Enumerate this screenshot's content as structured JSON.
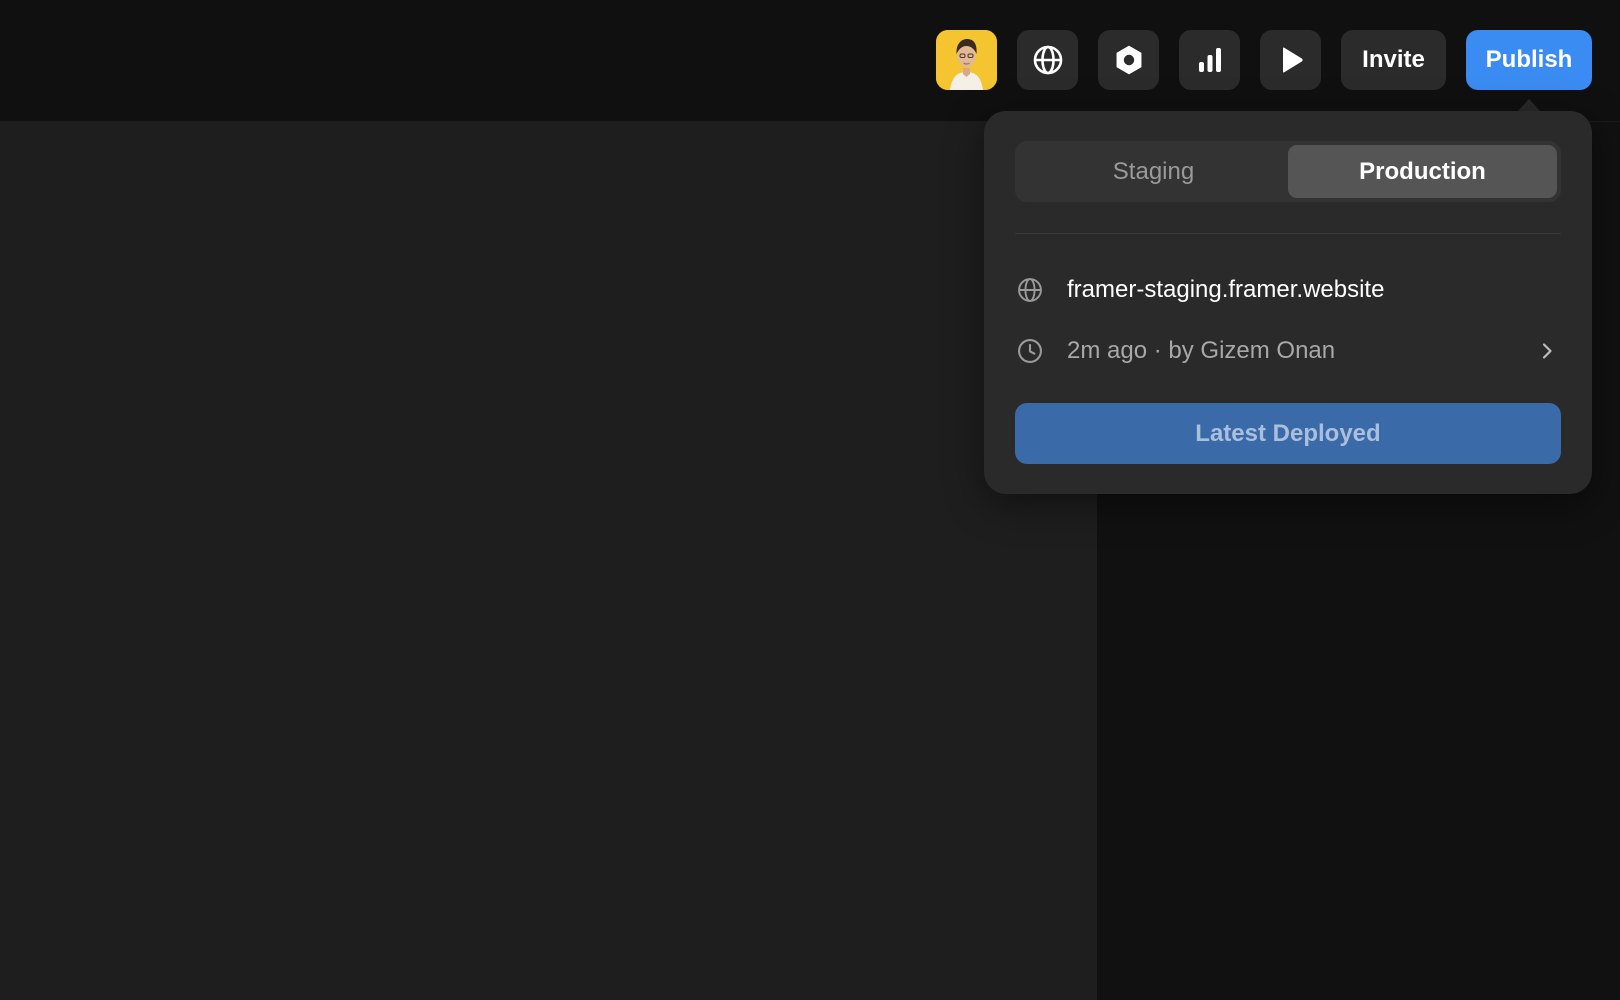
{
  "toolbar": {
    "avatar_icon": "user-avatar",
    "buttons": [
      {
        "icon": "globe-icon"
      },
      {
        "icon": "settings-hexagon-icon"
      },
      {
        "icon": "bar-chart-icon"
      },
      {
        "icon": "play-icon"
      }
    ],
    "invite_label": "Invite",
    "publish_label": "Publish"
  },
  "popover": {
    "tabs": [
      {
        "label": "Staging",
        "active": false
      },
      {
        "label": "Production",
        "active": true
      }
    ],
    "url": "framer-staging.framer.website",
    "last_update": "2m ago · by Gizem Onan",
    "deploy_label": "Latest Deployed"
  },
  "colors": {
    "accent": "#3b8cf2",
    "deploy_button": "#3a6aa8",
    "avatar_bg": "#f4c531",
    "canvas": "#1e1e1e",
    "topbar": "#101010"
  }
}
